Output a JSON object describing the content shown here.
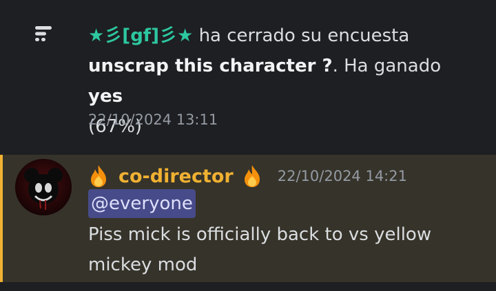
{
  "poll_message": {
    "username": "★彡[gf]彡★",
    "action_text": " ha cerrado su encuesta ",
    "question": "unscrap this character ?",
    "result_prefix": ". Ha ganado ",
    "winner": "yes",
    "winner_percent": "(67%)",
    "timestamp": "22/10/2024 13:11",
    "icon": "poll-icon"
  },
  "mention_message": {
    "author": "co-director",
    "author_emoji": "fire",
    "timestamp": "22/10/2024 14:21",
    "mention": "@everyone",
    "body": "Piss mick is officially back to vs yellow mickey mod",
    "accent_color": "#f0b132",
    "highlight_color": "#36332a"
  }
}
